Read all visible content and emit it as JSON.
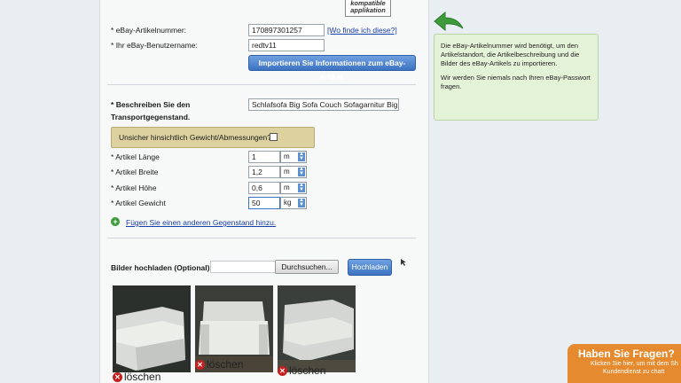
{
  "top_logo": "kompatible applikation",
  "form": {
    "item_number_label": "eBay-Artikelnummer:",
    "item_number_value": "170897301257",
    "where_link": "[Wo finde ich diese?]",
    "username_label": "Ihr eBay-Benutzername:",
    "username_value": "redtv11",
    "import_button": "Importieren Sie Informationen zum eBay-Artikel.",
    "describe_label_1": "Beschreiben Sie den",
    "describe_label_2": "Transportgegenstand.",
    "describe_value": "Schlafsofa Big Sofa Couch  Sofagarnitur Big Sofa",
    "unsure_label": "Unsicher hinsichtlich Gewicht/Abmessungen?",
    "length_label": "Artikel Länge",
    "length_value": "1",
    "length_unit": "m",
    "width_label": "Artikel Breite",
    "width_value": "1,2",
    "width_unit": "m",
    "height_label": "Artikel Höhe",
    "height_value": "0,6",
    "height_unit": "m",
    "weight_label": "Artikel Gewicht",
    "weight_value": "50",
    "weight_unit": "kg",
    "add_item_link": "Fügen Sie einen anderen Gegenstand hinzu.",
    "upload_label": "Bilder hochladen (Optional):",
    "browse_button": "Durchsuchen...",
    "upload_button": "Hochladen",
    "delete_label": "löschen"
  },
  "info_box": {
    "para1": "Die eBay-Artikelnummer wird benötigt, um den Artikelstandort, die Artikelbeschreibung und die Bilder des eBay-Artikels zu importieren.",
    "para2": "Wir werden Sie niemals nach Ihren eBay-Passwort fragen."
  },
  "help_tab": {
    "title": "Haben Sie Fragen?",
    "line1": "Klicken Sie hier, um mit dem Sh",
    "line2": "Kundendienst zu chatt"
  },
  "colors": {
    "accent_blue": "#3d73c2",
    "info_green": "#e4f2d8",
    "unsure_tan": "#dcd19f",
    "help_orange": "#e58a2e",
    "arrow_green": "#3e9a3a"
  }
}
